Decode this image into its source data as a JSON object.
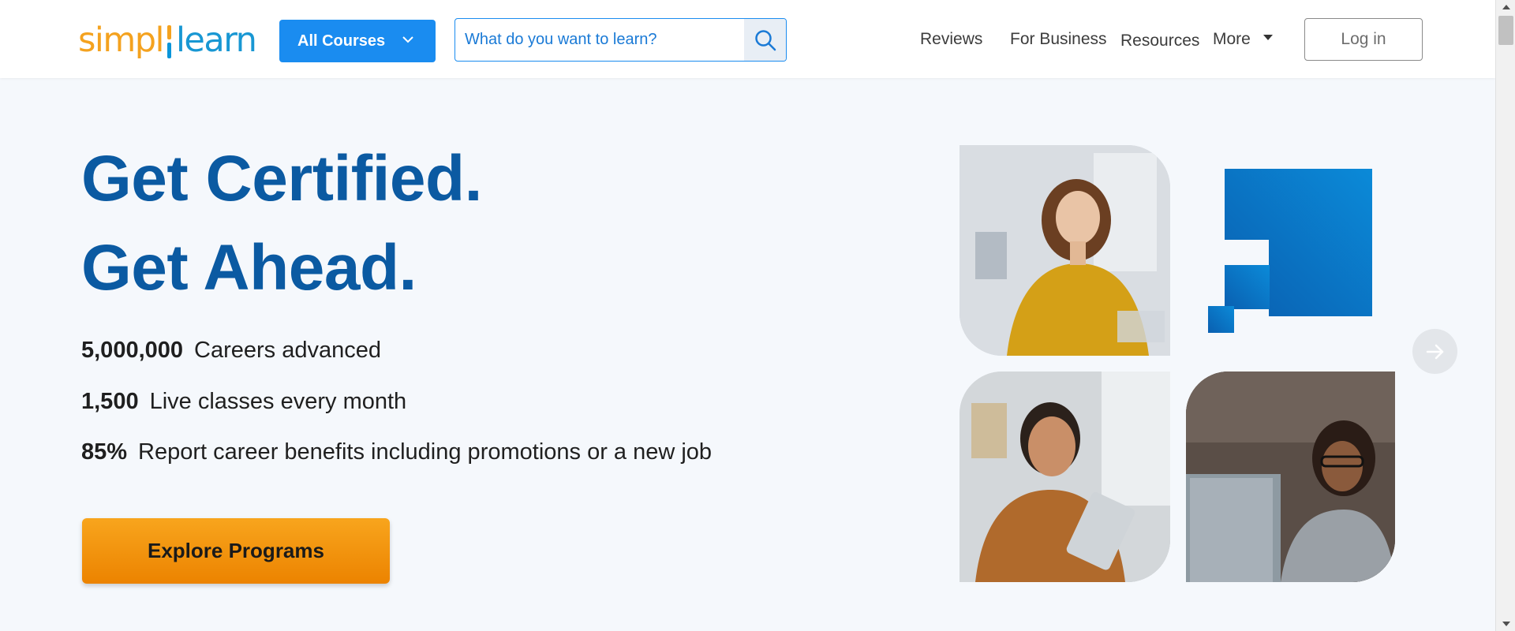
{
  "header": {
    "logo": {
      "part1": "simpl",
      "part2": "learn"
    },
    "all_courses_label": "All Courses",
    "search": {
      "placeholder": "What do you want to learn?",
      "value": ""
    },
    "nav": [
      "Reviews",
      "For Business",
      "Resources",
      "More"
    ],
    "login_label": "Log in"
  },
  "hero": {
    "headline_line1": "Get Certified.",
    "headline_line2": "Get Ahead.",
    "stats": [
      {
        "value": "5,000,000",
        "label": "Careers advanced"
      },
      {
        "value": "1,500",
        "label": "Live classes every month"
      },
      {
        "value": "85%",
        "label": "Report career benefits including promotions or a new job"
      }
    ],
    "cta_label": "Explore Programs"
  },
  "colors": {
    "brand_blue": "#0b5aa2",
    "accent_blue": "#1a8cf0",
    "cta_orange": "#f39a12",
    "logo_orange": "#f4a21f",
    "logo_blue": "#1897d3"
  },
  "icons": {
    "search": "search-icon",
    "dropdown": "chevron-down-icon",
    "more_caret": "caret-down-icon",
    "next": "arrow-right-icon",
    "brand_graphic": "brand-squares-graphic"
  }
}
